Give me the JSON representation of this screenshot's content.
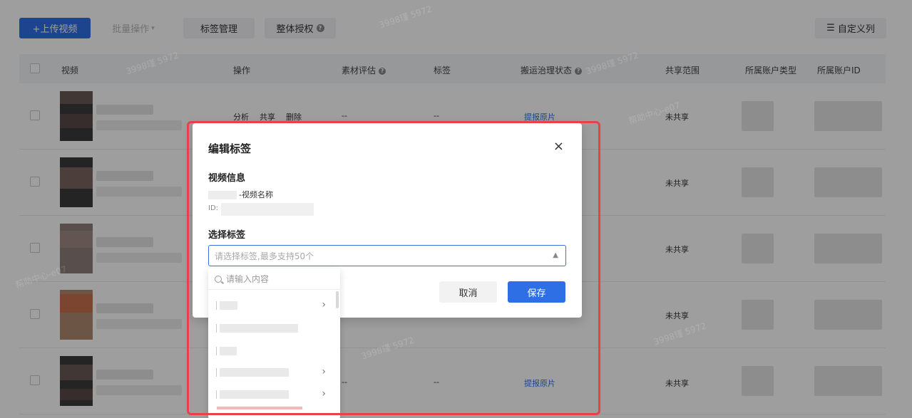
{
  "toolbar": {
    "upload_label": "+上传视频",
    "batch_label": "批量操作",
    "tag_mgmt_label": "标签管理",
    "auth_label": "整体授权",
    "custom_cols_label": "自定义列"
  },
  "table": {
    "headers": {
      "video": "视频",
      "ops": "操作",
      "material_eval": "素材评估",
      "tags": "标签",
      "governance": "搬运治理状态",
      "share_scope": "共享范围",
      "account_type": "所属账户类型",
      "account_id": "所属账户ID"
    },
    "rows": [
      {
        "ops_analyze": "分析",
        "ops_share": "共享",
        "ops_delete": "删除",
        "eval": "--",
        "tags": "--",
        "governance": "提报原片",
        "share": "未共享"
      },
      {
        "share": "未共享"
      },
      {
        "share": "未共享"
      },
      {
        "share": "未共享"
      },
      {
        "eval": "--",
        "tags": "--",
        "governance": "提报原片",
        "share": "未共享"
      }
    ]
  },
  "modal": {
    "title": "编辑标签",
    "close_glyph": "×",
    "video_info_title": "视频信息",
    "video_name": "-视频名称",
    "video_id_label": "ID:",
    "select_tags_title": "选择标签",
    "select_placeholder": "请选择标签,最多支持50个",
    "cancel_label": "取消",
    "save_label": "保存"
  },
  "dropdown": {
    "search_placeholder": "请输入内容",
    "chevron_glyph": "›"
  },
  "watermark": {
    "text_a": "3998瑾 5972",
    "text_b": "帮助中心-e07"
  },
  "colors": {
    "primary": "#2f6fe5",
    "highlight": "#e8414b"
  }
}
